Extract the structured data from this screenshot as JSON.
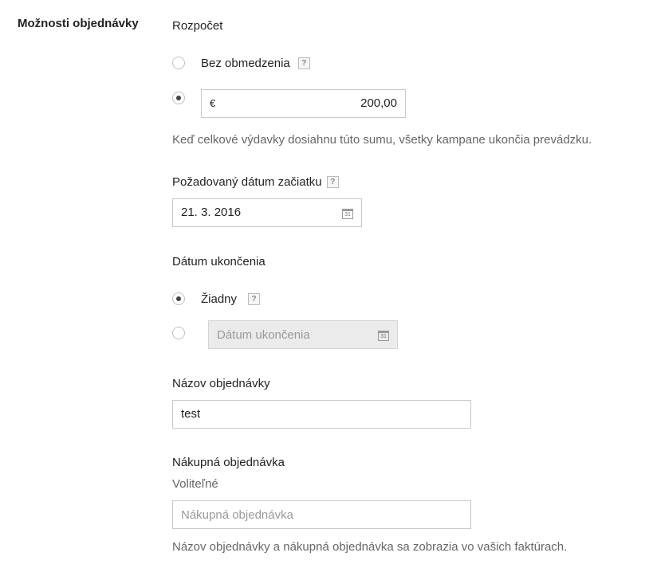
{
  "section": {
    "title": "Možnosti objednávky"
  },
  "budget": {
    "label": "Rozpočet",
    "unlimited_label": "Bez obmedzenia",
    "help_mark": "?",
    "currency_symbol": "€",
    "amount": "200,00",
    "hint": "Keď celkové výdavky dosiahnu túto sumu, všetky kampane ukončia prevádzku.",
    "selected_option": "amount"
  },
  "start_date": {
    "label": "Požadovaný dátum začiatku",
    "help_mark": "?",
    "value": "21. 3. 2016",
    "calendar_glyph": "31"
  },
  "end_date": {
    "label": "Dátum ukončenia",
    "none_label": "Žiadny",
    "help_mark": "?",
    "placeholder": "Dátum ukončenia",
    "calendar_glyph": "31",
    "selected_option": "none"
  },
  "order_name": {
    "label": "Názov objednávky",
    "value": "test"
  },
  "purchase_order": {
    "label": "Nákupná objednávka",
    "optional_label": "Voliteľné",
    "placeholder": "Nákupná objednávka",
    "hint": "Názov objednávky a nákupná objednávka sa zobrazia vo vašich faktúrach."
  }
}
